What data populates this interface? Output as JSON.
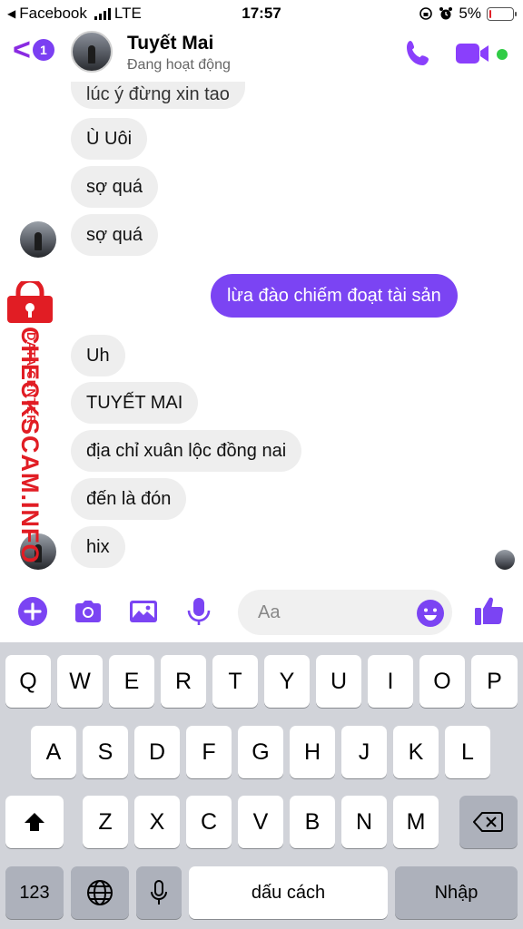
{
  "status_bar": {
    "back_app": "Facebook",
    "network": "LTE",
    "time": "17:57",
    "battery": "5%",
    "battery_level": 0.05
  },
  "header": {
    "badge_count": "1",
    "contact_name": "Tuyết Mai",
    "status": "Đang hoạt động",
    "accent_color": "#7b44f3",
    "online_color": "#31cc46"
  },
  "messages": [
    {
      "sender": "them",
      "text": "lúc ý đừng xin tao"
    },
    {
      "sender": "them",
      "text": "Ù Uôi"
    },
    {
      "sender": "them",
      "text": "sợ quá"
    },
    {
      "sender": "them",
      "text": "sợ quá"
    },
    {
      "sender": "me",
      "text": "lừa đào chiếm đoạt tài sản"
    },
    {
      "sender": "them",
      "text": "Uh"
    },
    {
      "sender": "them",
      "text": "TUYẾT MAI"
    },
    {
      "sender": "them",
      "text": "địa chỉ xuân lộc đồng nai"
    },
    {
      "sender": "them",
      "text": "đến là đón"
    },
    {
      "sender": "them",
      "text": "hix"
    }
  ],
  "watermark": {
    "brand": "CHECKSCAM.INFO",
    "tagline": "DATA CENTER",
    "color": "#e11d24"
  },
  "composer": {
    "placeholder": "Aa",
    "icons": [
      "plus-icon",
      "camera-icon",
      "image-icon",
      "microphone-icon",
      "emoji-icon",
      "like-icon"
    ]
  },
  "keyboard": {
    "row1": [
      "Q",
      "W",
      "E",
      "R",
      "T",
      "Y",
      "U",
      "I",
      "O",
      "P"
    ],
    "row2": [
      "A",
      "S",
      "D",
      "F",
      "G",
      "H",
      "J",
      "K",
      "L"
    ],
    "row3": [
      "Z",
      "X",
      "C",
      "V",
      "B",
      "N",
      "M"
    ],
    "numbers_key": "123",
    "space_key": "dấu cách",
    "return_key": "Nhập"
  }
}
